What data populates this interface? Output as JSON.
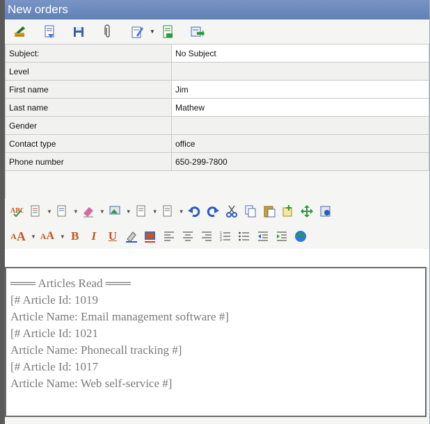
{
  "window": {
    "title": "New orders"
  },
  "toolbar": {
    "icons": [
      "broom-icon",
      "document-icon",
      "save-icon",
      "paperclip-icon",
      "edit-icon",
      "document-add-icon",
      "forward-icon"
    ]
  },
  "form": {
    "rows": [
      {
        "label": "Subject:",
        "value": "No Subject"
      },
      {
        "label": "Level",
        "value": ""
      },
      {
        "label": "First name",
        "value": "Jim"
      },
      {
        "label": "Last name",
        "value": "Mathew"
      },
      {
        "label": "Gender",
        "value": ""
      },
      {
        "label": "Contact type",
        "value": "office"
      },
      {
        "label": "Phone number",
        "value": "650-299-7800"
      }
    ]
  },
  "editor": {
    "lines": [
      "═══ Articles Read ═══",
      "[# Article Id: 1019",
      "Article Name: Email management software #]",
      "[# Article Id: 1021",
      "Article Name: Phonecall tracking #]",
      "[# Article Id: 1017",
      "Article Name: Web self-service #]"
    ]
  },
  "format_toolbar": {
    "font_size_up": "A",
    "font_size_down": "A",
    "bold": "B",
    "italic": "I",
    "underline": "U"
  },
  "colors": {
    "titlebar": "#6b89bd",
    "accent_red": "#c8541c"
  }
}
